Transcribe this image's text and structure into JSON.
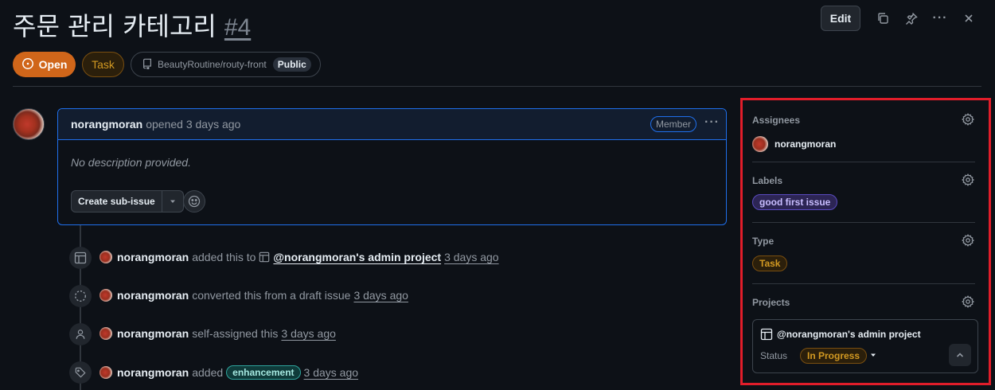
{
  "issue": {
    "title": "주문 관리 카테고리",
    "number": "#4"
  },
  "header": {
    "edit_label": "Edit",
    "icons": [
      "copy-icon",
      "pin-icon",
      "kebab-icon",
      "close-icon"
    ]
  },
  "badges": {
    "state": "Open",
    "type": "Task",
    "repo": "BeautyRoutine/routy-front",
    "visibility": "Public"
  },
  "comment": {
    "author": "norangmoran",
    "meta": "opened 3 days ago",
    "role": "Member",
    "body": "No description provided.",
    "sub_issue_label": "Create sub-issue"
  },
  "timeline": {
    "events": [
      {
        "user": "norangmoran",
        "text": "added this to",
        "project": "@norangmoran's admin project",
        "time": "3 days ago"
      },
      {
        "user": "norangmoran",
        "text": "converted this from a draft issue",
        "time": "3 days ago"
      },
      {
        "user": "norangmoran",
        "text": "self-assigned this",
        "time": "3 days ago"
      },
      {
        "user": "norangmoran",
        "text": "added",
        "label": "enhancement",
        "time": "3 days ago"
      }
    ]
  },
  "sidebar": {
    "assignees_heading": "Assignees",
    "assignee": "norangmoran",
    "labels_heading": "Labels",
    "label": "good first issue",
    "type_heading": "Type",
    "type": "Task",
    "projects_heading": "Projects",
    "project_name": "@norangmoran's admin project",
    "status_label": "Status",
    "status_value": "In Progress"
  },
  "colors": {
    "accent_open": "#d0661a",
    "highlight_box": "#e11d2a",
    "comment_border": "#1f6feb"
  }
}
